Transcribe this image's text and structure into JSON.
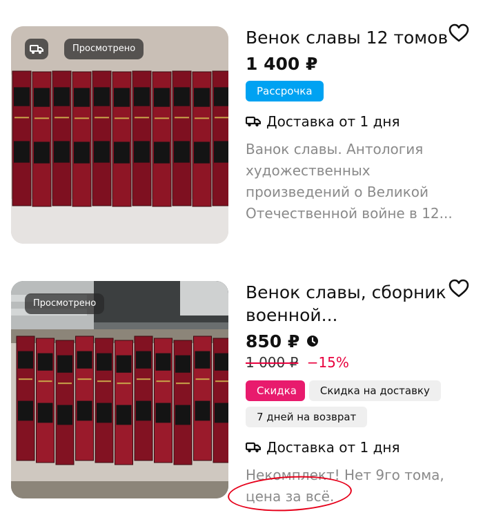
{
  "listings": [
    {
      "title": "Венок славы 12 томов",
      "price": "1 400 ₽",
      "viewed_badge": "Просмотрено",
      "chips": [
        "Рассрочка"
      ],
      "delivery": "Доставка от 1 дня",
      "description": "Ванок славы. Антология художественных произведений о Великой Отечественной войне в 12..."
    },
    {
      "title": "Венок славы, сборник военной...",
      "price": "850 ₽",
      "old_price": "1 000 ₽",
      "discount": "−15%",
      "viewed_badge": "Просмотрено",
      "chips": [
        "Скидка",
        "Скидка на доставку",
        "7 дней на возврат"
      ],
      "delivery": "Доставка от 1 дня",
      "description": "Некомплект! Нет 9го тома, цена за всё."
    }
  ],
  "colors": {
    "chip_installment": "#00a2f2",
    "chip_sale": "#e81b6d",
    "discount_text": "#e8003d",
    "annotation_circle": "#e6001a"
  },
  "icons": [
    "heart-icon",
    "truck-icon",
    "clock-icon"
  ]
}
